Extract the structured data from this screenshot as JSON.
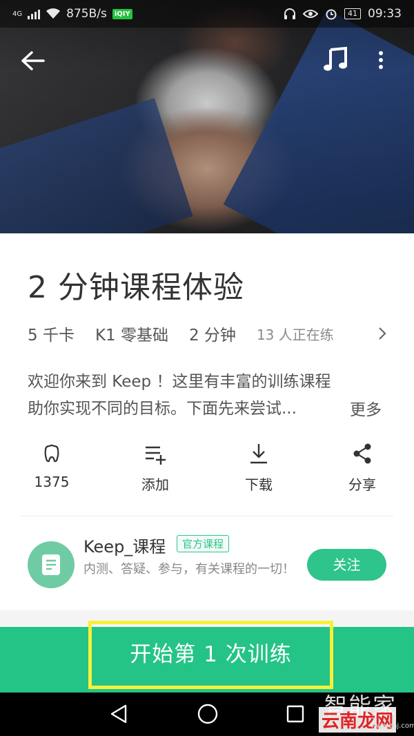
{
  "status_bar": {
    "network": "4G",
    "speed": "875B/s",
    "app_badge": "iQIY",
    "battery": "41",
    "time": "09:33"
  },
  "course": {
    "title": "2 分钟课程体验",
    "meta": [
      "5 千卡",
      "K1 零基础",
      "2 分钟"
    ],
    "live_count": "13 人正在练",
    "description_line1": "欢迎你来到 Keep ！这里有丰富的训练课程",
    "description_line2": "助你实现不同的目标。下面先来尝试...",
    "more_label": "更多"
  },
  "actions": [
    {
      "icon": "thumbs-up-icon",
      "label": "1375"
    },
    {
      "icon": "add-list-icon",
      "label": "添加"
    },
    {
      "icon": "download-icon",
      "label": "下载"
    },
    {
      "icon": "share-icon",
      "label": "分享"
    }
  ],
  "author": {
    "name": "Keep_课程",
    "tag": "官方课程",
    "description": "内测、答疑、参与，有关课程的一切！",
    "follow_label": "关注"
  },
  "start_button": {
    "label": "开始第 1 次训练",
    "highlight_color": "#f7f03a"
  },
  "watermark": {
    "line1": "智能家",
    "line2": "云南龙网",
    "url": "www.znj.com"
  },
  "colors": {
    "brand_green": "#24c486",
    "accent_green": "#2ec48b"
  }
}
